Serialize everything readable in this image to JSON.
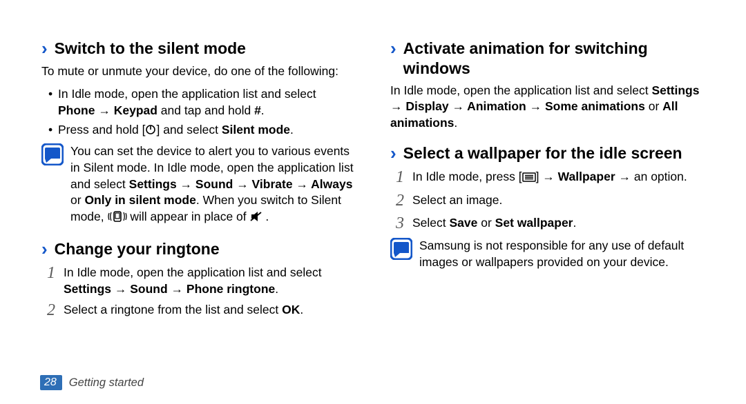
{
  "left": {
    "section1": {
      "title": "Switch to the silent mode",
      "intro": "To mute or unmute your device, do one of the following:",
      "bullet1": {
        "pre": "In Idle mode, open the application list and select ",
        "phone": "Phone",
        "arrow": " → ",
        "keypad": "Keypad",
        "post1": " and tap and hold ",
        "hash": "#",
        "post2": "."
      },
      "bullet2": {
        "pre": "Press and hold [",
        "post1": "] and select ",
        "silent": "Silent mode",
        "post2": "."
      },
      "note": {
        "pre": "You can set the device to alert you to various events in Silent mode. In Idle mode, open the application list and select ",
        "path": "Settings → Sound → Vibrate → Always",
        "or": " or ",
        "only": "Only in silent mode",
        "mid": ". When you switch to Silent mode, ",
        "post": " will appear in place of ",
        "end": " ."
      }
    },
    "section2": {
      "title": "Change your ringtone",
      "step1": {
        "num": "1",
        "pre": "In Idle mode, open the application list and select ",
        "path": "Settings → Sound → Phone ringtone",
        "post": "."
      },
      "step2": {
        "num": "2",
        "pre": "Select a ringtone from the list and select ",
        "ok": "OK",
        "post": "."
      }
    }
  },
  "right": {
    "section1": {
      "title": "Activate animation for switching windows",
      "body": {
        "pre": "In Idle mode, open the application list and select ",
        "path": "Settings → Display → Animation → Some animations",
        "or": " or ",
        "all": "All animations",
        "post": "."
      }
    },
    "section2": {
      "title": "Select a wallpaper for the idle screen",
      "step1": {
        "num": "1",
        "pre": "In Idle mode, press [",
        "mid": "] → ",
        "wall": "Wallpaper",
        "post": " → an option."
      },
      "step2": {
        "num": "2",
        "text": "Select an image."
      },
      "step3": {
        "num": "3",
        "pre": "Select ",
        "save": "Save",
        "or": " or ",
        "setw": "Set wallpaper",
        "post": "."
      },
      "note": "Samsung is not responsible for any use of default images or wallpapers provided on your device."
    }
  },
  "footer": {
    "page": "28",
    "label": "Getting started"
  },
  "glyphs": {
    "chevron": "›",
    "arrow": "→"
  }
}
